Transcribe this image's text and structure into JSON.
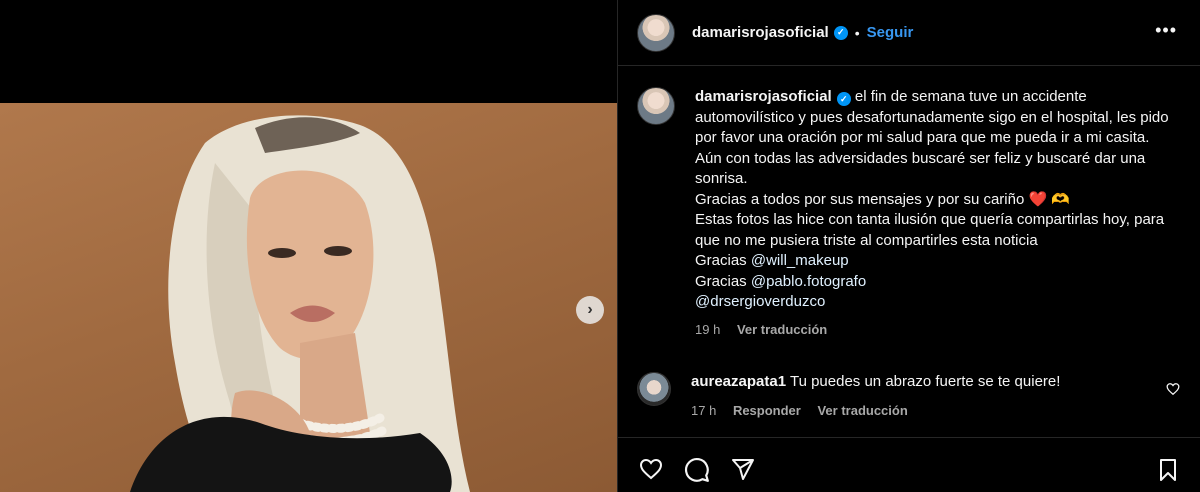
{
  "post": {
    "username": "damarisrojasoficial",
    "follow_label": "Seguir",
    "separator": "•",
    "more_label": "•••",
    "next_label": "›"
  },
  "caption": {
    "username": "damarisrojasoficial",
    "line1": "el fin de semana tuve un accidente automovilístico y pues desafortunadamente sigo en el hospital, les pido por favor una oración por mi salud para que me pueda ir a mi casita. Aún con todas las adversidades buscaré ser feliz y buscaré dar una sonrisa.",
    "line2": "Gracias a todos por sus mensajes y por su cariño ❤️ 🫶",
    "line3": "Estas fotos las hice con tanta ilusión que quería compartirlas hoy, para que no me pusiera triste al compartirles esta noticia",
    "thanks1_prefix": "Gracias ",
    "thanks1_mention": "@will_makeup",
    "thanks2_prefix": "Gracias ",
    "thanks2_mention": "@pablo.fotografo",
    "mention3": "@drsergioverduzco",
    "time": "19 h",
    "translate": "Ver traducción"
  },
  "comment": {
    "username": "aureazapata1",
    "text": "Tu puedes un abrazo fuerte se te quiere!",
    "time": "17 h",
    "reply": "Responder",
    "translate": "Ver traducción"
  },
  "icons": [
    "heart-icon",
    "comment-icon",
    "share-icon",
    "bookmark-icon",
    "verified-icon",
    "chevron-right-icon",
    "more-icon"
  ],
  "colors": {
    "accent": "#0095f6",
    "background": "#000000",
    "muted": "#a8a8a8",
    "photo_bg": "#a06a40"
  }
}
